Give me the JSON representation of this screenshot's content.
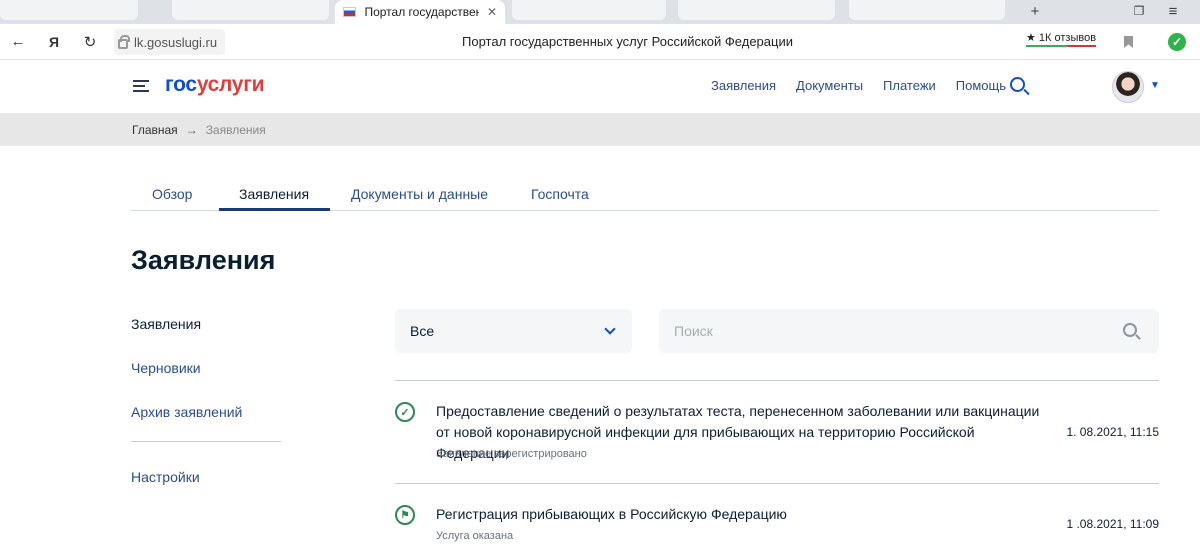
{
  "browser": {
    "tab_title": "Портал государственных",
    "url": "lk.gosuslugi.ru",
    "page_title": "Портал государственных услуг Российской Федерации",
    "reviews": "★ 1К отзывов"
  },
  "header": {
    "logo_part1": "гос",
    "logo_part2": "услуги",
    "nav": [
      "Заявления",
      "Документы",
      "Платежи",
      "Помощь"
    ]
  },
  "breadcrumb": {
    "home": "Главная",
    "arrow": "→",
    "current": "Заявления"
  },
  "tabs": [
    "Обзор",
    "Заявления",
    "Документы и данные",
    "Госпочта"
  ],
  "page_title": "Заявления",
  "side_menu": [
    "Заявления",
    "Черновики",
    "Архив заявлений",
    "Настройки"
  ],
  "filters": {
    "select_value": "Все",
    "search_placeholder": "Поиск"
  },
  "applications": [
    {
      "title": "Предоставление сведений о результатах теста, перенесенном заболевании или вакцинации от новой коронавирусной инфекции для прибывающих на территорию Российской Федерации",
      "status": "Заявление зарегистрировано",
      "date": "1.  08.2021, 11:15",
      "icon": "check-icon"
    },
    {
      "title": "Регистрация прибывающих в Российскую Федерацию",
      "status": "Услуга оказана",
      "date": "1  .08.2021, 11:09",
      "icon": "flag-icon"
    }
  ]
}
